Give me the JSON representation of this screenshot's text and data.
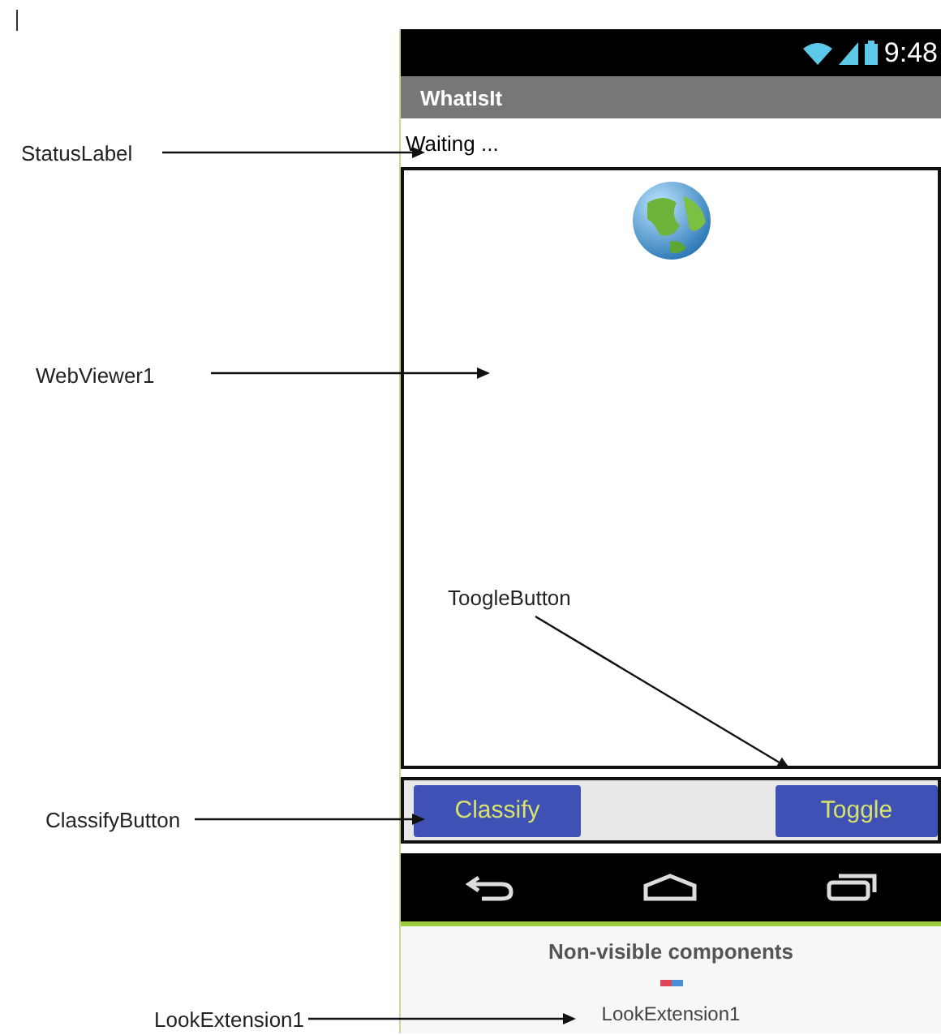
{
  "phone": {
    "status_bar": {
      "time": "9:48"
    },
    "app_title": "WhatIsIt",
    "status_label": "Waiting ...",
    "buttons": [
      {
        "label": "Classify"
      },
      {
        "label": "Toggle"
      }
    ],
    "non_visible": {
      "heading": "Non-visible components",
      "components": [
        "LookExtension1"
      ]
    }
  },
  "annotations": [
    {
      "label": "StatusLabel"
    },
    {
      "label": "WebViewer1"
    },
    {
      "label": "ToogleButton"
    },
    {
      "label": "ClassifyButton"
    },
    {
      "label": "LookExtension1"
    }
  ]
}
